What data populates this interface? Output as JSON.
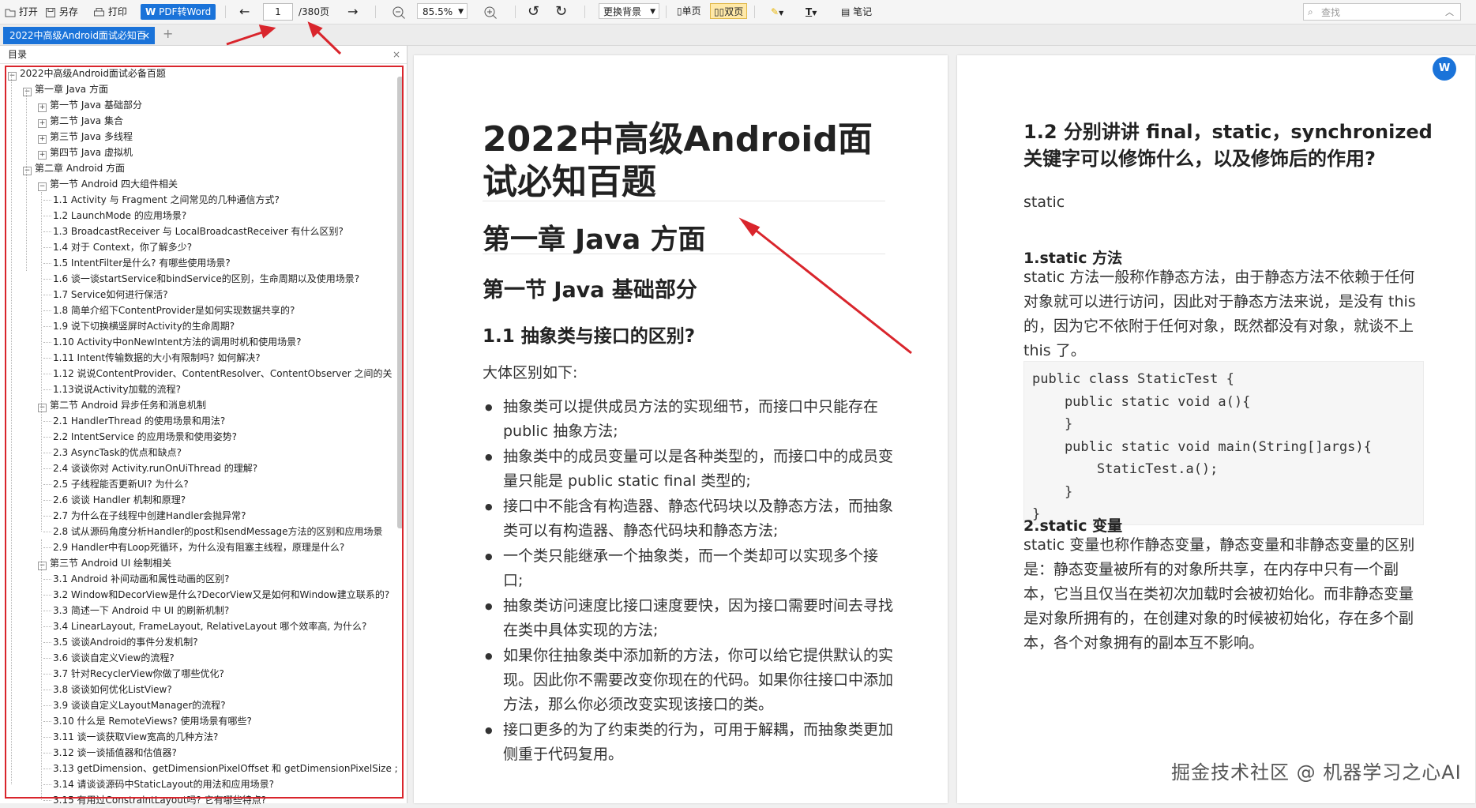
{
  "toolbar": {
    "open": "打开",
    "save_as": "另存",
    "print": "打印",
    "pdf_to_word": "PDF转Word",
    "page_current": "1",
    "page_total": "/380页",
    "zoom": "85.5%",
    "background": "更换背景",
    "single_page": "单页",
    "double_page": "双页",
    "notes": "笔记",
    "search_placeholder": "查找"
  },
  "tab": {
    "title": "2022中高级Android面试必知百",
    "close": "×",
    "new": "+"
  },
  "sidebar": {
    "title": "目录",
    "close": "×"
  },
  "toc": [
    {
      "level": 0,
      "toggle": "-",
      "text": "2022中高级Android面试必备百题"
    },
    {
      "level": 1,
      "toggle": "-",
      "text": "第一章 Java 方面"
    },
    {
      "level": 2,
      "toggle": "+",
      "text": "第一节 Java 基础部分"
    },
    {
      "level": 2,
      "toggle": "+",
      "text": "第二节 Java 集合"
    },
    {
      "level": 2,
      "toggle": "+",
      "text": "第三节 Java 多线程"
    },
    {
      "level": 2,
      "toggle": "+",
      "text": "第四节 Java 虚拟机"
    },
    {
      "level": 1,
      "toggle": "-",
      "text": "第二章 Android 方面"
    },
    {
      "level": 2,
      "toggle": "-",
      "text": "第一节 Android 四大组件相关"
    },
    {
      "level": 3,
      "toggle": "",
      "text": "1.1 Activity 与 Fragment 之间常见的几种通信方式?"
    },
    {
      "level": 3,
      "toggle": "",
      "text": "1.2 LaunchMode 的应用场景?"
    },
    {
      "level": 3,
      "toggle": "",
      "text": "1.3 BroadcastReceiver 与 LocalBroadcastReceiver 有什么区别?"
    },
    {
      "level": 3,
      "toggle": "",
      "text": "1.4 对于 Context，你了解多少?"
    },
    {
      "level": 3,
      "toggle": "",
      "text": "1.5 IntentFilter是什么? 有哪些使用场景?"
    },
    {
      "level": 3,
      "toggle": "",
      "text": "1.6 谈一谈startService和bindService的区别，生命周期以及使用场景?"
    },
    {
      "level": 3,
      "toggle": "",
      "text": "1.7 Service如何进行保活?"
    },
    {
      "level": 3,
      "toggle": "",
      "text": "1.8 简单介绍下ContentProvider是如何实现数据共享的?"
    },
    {
      "level": 3,
      "toggle": "",
      "text": "1.9 说下切换横竖屏时Activity的生命周期?"
    },
    {
      "level": 3,
      "toggle": "",
      "text": "1.10 Activity中onNewIntent方法的调用时机和使用场景?"
    },
    {
      "level": 3,
      "toggle": "",
      "text": "1.11 Intent传输数据的大小有限制吗? 如何解决?"
    },
    {
      "level": 3,
      "toggle": "",
      "text": "1.12 说说ContentProvider、ContentResolver、ContentObserver 之间的关"
    },
    {
      "level": 3,
      "toggle": "",
      "text": "1.13说说Activity加载的流程?"
    },
    {
      "level": 2,
      "toggle": "-",
      "text": "第二节 Android 异步任务和消息机制"
    },
    {
      "level": 3,
      "toggle": "",
      "text": "2.1 HandlerThread 的使用场景和用法?"
    },
    {
      "level": 3,
      "toggle": "",
      "text": "2.2 IntentService 的应用场景和使用姿势?"
    },
    {
      "level": 3,
      "toggle": "",
      "text": "2.3 AsyncTask的优点和缺点?"
    },
    {
      "level": 3,
      "toggle": "",
      "text": "2.4 谈谈你对 Activity.runOnUiThread 的理解?"
    },
    {
      "level": 3,
      "toggle": "",
      "text": "2.5 子线程能否更新UI? 为什么?"
    },
    {
      "level": 3,
      "toggle": "",
      "text": "2.6 谈谈 Handler 机制和原理?"
    },
    {
      "level": 3,
      "toggle": "",
      "text": "2.7 为什么在子线程中创建Handler会抛异常?"
    },
    {
      "level": 3,
      "toggle": "",
      "text": "2.8 试从源码角度分析Handler的post和sendMessage方法的区别和应用场景"
    },
    {
      "level": 3,
      "toggle": "",
      "text": "2.9 Handler中有Loop死循环，为什么没有阻塞主线程，原理是什么?"
    },
    {
      "level": 2,
      "toggle": "-",
      "text": "第三节 Android UI 绘制相关"
    },
    {
      "level": 3,
      "toggle": "",
      "text": "3.1 Android 补间动画和属性动画的区别?"
    },
    {
      "level": 3,
      "toggle": "",
      "text": "3.2 Window和DecorView是什么?DecorView又是如何和Window建立联系的?"
    },
    {
      "level": 3,
      "toggle": "",
      "text": "3.3 简述一下 Android 中 UI 的刷新机制?"
    },
    {
      "level": 3,
      "toggle": "",
      "text": "3.4 LinearLayout, FrameLayout, RelativeLayout 哪个效率高, 为什么?"
    },
    {
      "level": 3,
      "toggle": "",
      "text": "3.5 谈谈Android的事件分发机制?"
    },
    {
      "level": 3,
      "toggle": "",
      "text": "3.6 谈谈自定义View的流程?"
    },
    {
      "level": 3,
      "toggle": "",
      "text": "3.7 针对RecyclerView你做了哪些优化?"
    },
    {
      "level": 3,
      "toggle": "",
      "text": "3.8 谈谈如何优化ListView?"
    },
    {
      "level": 3,
      "toggle": "",
      "text": "3.9 谈谈自定义LayoutManager的流程?"
    },
    {
      "level": 3,
      "toggle": "",
      "text": "3.10 什么是 RemoteViews? 使用场景有哪些?"
    },
    {
      "level": 3,
      "toggle": "",
      "text": "3.11 谈一谈获取View宽高的几种方法?"
    },
    {
      "level": 3,
      "toggle": "",
      "text": "3.12 谈一谈插值器和估值器?"
    },
    {
      "level": 3,
      "toggle": "",
      "text": "3.13 getDimension、getDimensionPixelOffset 和 getDimensionPixelSize ;"
    },
    {
      "level": 3,
      "toggle": "",
      "text": "3.14 请谈谈源码中StaticLayout的用法和应用场景?"
    },
    {
      "level": 3,
      "toggle": "",
      "text": "3.15 有用过ConstraintLayout吗? 它有哪些特点?"
    }
  ],
  "page1": {
    "title": "2022中高级Android面试必知百题",
    "chapter": "第一章 Java 方面",
    "section": "第一节 Java 基础部分",
    "question": "1.1 抽象类与接口的区别?",
    "intro": "大体区别如下:",
    "bullets": [
      "抽象类可以提供成员方法的实现细节，而接口中只能存在 public 抽象方法;",
      "抽象类中的成员变量可以是各种类型的，而接口中的成员变量只能是 public static final 类型的;",
      "接口中不能含有构造器、静态代码块以及静态方法，而抽象类可以有构造器、静态代码块和静态方法;",
      "一个类只能继承一个抽象类，而一个类却可以实现多个接口;",
      "抽象类访问速度比接口速度要快，因为接口需要时间去寻找在类中具体实现的方法;",
      "如果你往抽象类中添加新的方法，你可以给它提供默认的实现。因此你不需要改变你现在的代码。如果你往接口中添加方法，那么你必须改变实现该接口的类。",
      "接口更多的为了约束类的行为，可用于解耦，而抽象类更加侧重于代码复用。"
    ]
  },
  "page2": {
    "question": "1.2 分别讲讲 final，static，synchronized 关键字可以修饰什么，以及修饰后的作用?",
    "word": "static",
    "sub1": "1.static 方法",
    "para1": "static 方法一般称作静态方法，由于静态方法不依赖于任何对象就可以进行访问，因此对于静态方法来说，是没有 this 的，因为它不依附于任何对象，既然都没有对象，就谈不上 this 了。",
    "code": "public class StaticTest {\n    public static void a(){\n    }\n    public static void main(String[]args){\n        StaticTest.a();\n    }\n}",
    "sub2": "2.static 变量",
    "para2": "static 变量也称作静态变量，静态变量和非静态变量的区别是：静态变量被所有的对象所共享，在内存中只有一个副本，它当且仅当在类初次加载时会被初始化。而非静态变量是对象所拥有的，在创建对象的时候被初始化，存在多个副本，各个对象拥有的副本互不影响。"
  },
  "fab": "W",
  "watermark": "掘金技术社区 @ 机器学习之心AI",
  "colors": {
    "accent": "#1a73d9",
    "annotation_red": "#d9252c"
  }
}
